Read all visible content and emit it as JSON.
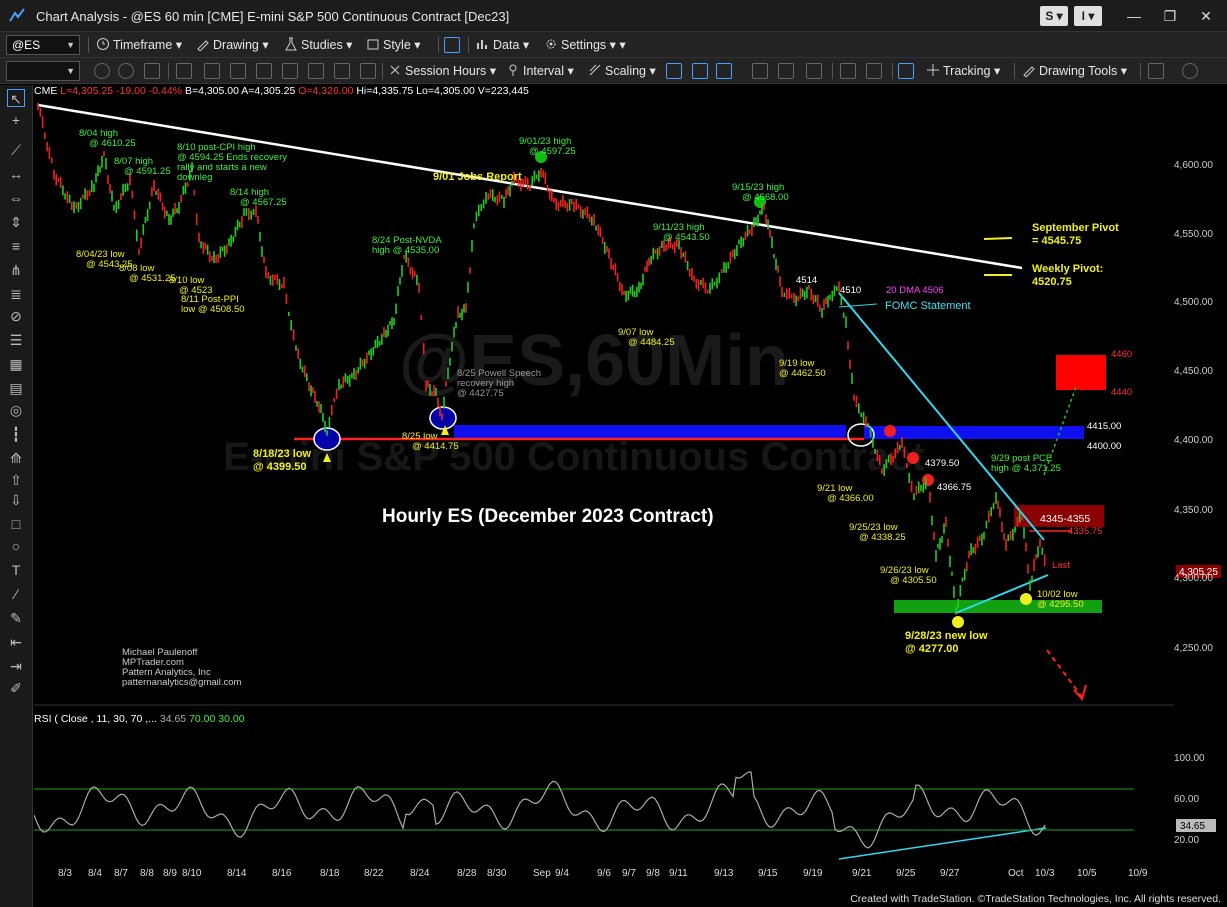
{
  "window": {
    "title": "Chart Analysis - @ES 60 min [CME] E-mini S&P 500 Continuous Contract [Dec23]",
    "buttons": [
      "S",
      "I"
    ],
    "controls": [
      "—",
      "❐",
      "✕"
    ]
  },
  "toolbar1": {
    "symbol": "@ES",
    "items": [
      "Timeframe",
      "Drawing",
      "Studies",
      "Style",
      "Data",
      "Settings"
    ]
  },
  "toolbar2": {
    "items": [
      "Session Hours",
      "Interval",
      "Scaling",
      "Tracking",
      "Drawing Tools"
    ]
  },
  "quote": {
    "exchange": "CME",
    "last": "L=4,305.25",
    "change": "-19.00",
    "pct": "-0.44%",
    "bid": "B=4,305.00",
    "ask": "A=4,305.25",
    "open": "O=4,326.00",
    "high": "Hi=4,335.75",
    "low": "Lo=4,305.00",
    "volume": "V=223,445"
  },
  "watermark": {
    "big": "@ES,60Min",
    "sub": "E-mini S&P 500 Continuous Contract"
  },
  "chart_title": "Hourly ES (December 2023 Contract)",
  "annotations": {
    "a01": "8/04 high",
    "a02": "@ 4610.25",
    "a03": "8/07 high",
    "a04": "@ 4591.25",
    "a05": "8/10 post-CPI high",
    "a06": "@ 4594.25 Ends recovery",
    "a07": "rally and starts a new",
    "a08": "downleg",
    "a09": "8/14 high",
    "a10": "@ 4567.25",
    "a11": "8/04/23 low",
    "a12": "@ 4543.25",
    "a13": "8/08 low",
    "a14": "@ 4531.25",
    "a15": "8/10 low",
    "a16": "@ 4523",
    "a17": "8/11 Post-PPI",
    "a18": "low @ 4508.50",
    "a19": "8/24 Post-NVDA",
    "a20": "high @ 4535.00",
    "a21": "9/01/23 high",
    "a22": "@ 4597.25",
    "a23": "9/01 Jobs Report",
    "a24": "9/11/23 high",
    "a25": "@ 4543.50",
    "a26": "9/15/23 high",
    "a27": "@ 4568.00",
    "a28": "9/07 low",
    "a29": "@ 4484.25",
    "a30": "9/19 low",
    "a31": "@ 4462.50",
    "a32": "4514",
    "a33": "4510",
    "a34": "20 DMA 4506",
    "a35": "FOMC Statement",
    "a36": "September Pivot",
    "a37": "= 4545.75",
    "a38": "Weekly Pivot:",
    "a39": "4520.75",
    "a40": "8/25 Powell Speech",
    "a41": "recovery high",
    "a42": "@ 4427.75",
    "a43": "8/25 low",
    "a44": "@ 4414.75",
    "a45": "8/18/23 low",
    "a46": "@ 4399.50",
    "a47": "4460",
    "a48": "4440",
    "a49": "4415.00",
    "a50": "4400.00",
    "a51": "9/21 low",
    "a52": "@ 4366.00",
    "a53": "4379.50",
    "a54": "4366.75",
    "a55": "9/29 post PCE",
    "a56": "high @ 4,371.25",
    "a57": "4345-4355",
    "a58": "4335.75",
    "a59": "9/25/23 low",
    "a60": "@ 4338.25",
    "a61": "9/26/23 low",
    "a62": "@ 4305.50",
    "a63": "Last",
    "a64": "4,305.25",
    "a65": "10/02 low",
    "a66": "@ 4295.50",
    "a67": "9/28/23 new low",
    "a68": "@ 4277.00",
    "a69": "Michael Paulenoff",
    "a70": "MPTrader.com",
    "a71": "Pattern Analytics, Inc",
    "a72": "patternanalytics@gmail.com"
  },
  "rsi": {
    "label": "RSI ( Close , 11, 30, 70 ,...",
    "value": "34.65",
    "ob": "70.00",
    "os": "30.00",
    "current": "34.65"
  },
  "price_axis": [
    "4,600.00",
    "4,550.00",
    "4,500.00",
    "4,450.00",
    "4,400.00",
    "4,350.00",
    "4,300.00",
    "4,250.00"
  ],
  "rsi_axis": [
    "100.00",
    "60.00",
    "20.00"
  ],
  "x_axis": [
    "8/3",
    "8/4",
    "8/7",
    "8/8",
    "8/9",
    "8/10",
    "8/14",
    "8/16",
    "8/18",
    "8/22",
    "8/24",
    "8/28",
    "8/30",
    "Sep",
    "9/4",
    "9/6",
    "9/7",
    "9/8",
    "9/11",
    "9/13",
    "9/15",
    "9/19",
    "9/21",
    "9/25",
    "9/27",
    "Oct",
    "10/3",
    "10/5",
    "10/9"
  ],
  "footer": "Created with TradeStation. ©TradeStation Technologies, Inc. All rights reserved.",
  "colors": {
    "up": "#22cc22",
    "down": "#ee2222",
    "trendline": "#ffffff",
    "support": "#ff2020",
    "zone_blue": "#1010ee",
    "zone_green": "#10a010",
    "cyan": "#30d8ee"
  }
}
